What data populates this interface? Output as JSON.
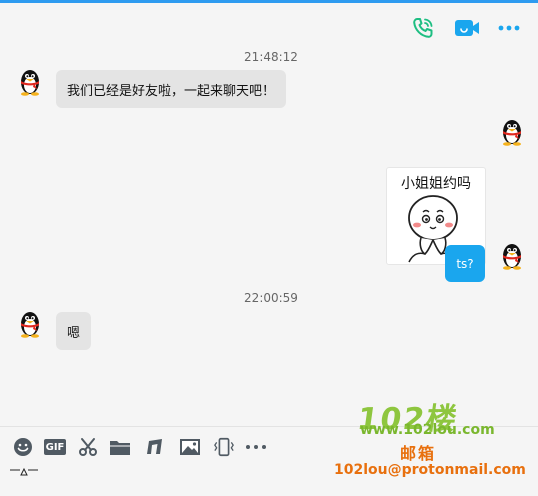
{
  "header": {
    "icons": [
      "phone-call-icon",
      "video-call-icon",
      "more-options-icon"
    ],
    "colors": {
      "phone": "#1ebe82",
      "video": "#1aa6ee",
      "more": "#1aa6ee"
    }
  },
  "messages": [
    {
      "type": "timestamp",
      "text": "21:48:12"
    },
    {
      "type": "incoming",
      "text": "我们已经是好友啦，一起来聊天吧！"
    },
    {
      "type": "outgoing-sticker",
      "text": "小姐姐约吗"
    },
    {
      "type": "outgoing",
      "text": "ts?"
    },
    {
      "type": "timestamp",
      "text": "22:00:59"
    },
    {
      "type": "incoming",
      "text": "嗯"
    }
  ],
  "toolbar": {
    "gif_label": "GIF",
    "items": [
      "emoji-icon",
      "gif-icon",
      "scissors-icon",
      "folder-icon",
      "music-icon",
      "image-icon",
      "shake-icon",
      "more-icon"
    ]
  },
  "watermark": {
    "logo": "102楼",
    "url": "www.102lou.com",
    "mail_label": "邮箱",
    "mail": "102lou@protonmail.com"
  }
}
